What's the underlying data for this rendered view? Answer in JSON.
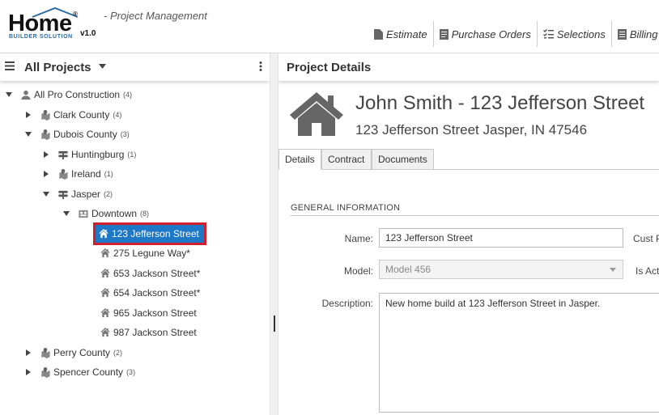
{
  "app": {
    "logo_text": "Home",
    "logo_reg": "®",
    "logo_sub": "BUILDER SOLUTION",
    "version": "v1.0",
    "subtitle": "- Project Management"
  },
  "toolbar": {
    "estimate": "Estimate",
    "purchase_orders": "Purchase Orders",
    "selections": "Selections",
    "billing": "Billing"
  },
  "left": {
    "title": "All Projects",
    "tree": [
      {
        "label": "All Pro Construction",
        "count": "(4)",
        "toggle": "open",
        "icon": "person"
      },
      {
        "label": "Clark County",
        "count": "(4)",
        "toggle": "closed",
        "icon": "county"
      },
      {
        "label": "Dubois County",
        "count": "(3)",
        "toggle": "open",
        "icon": "county"
      },
      {
        "label": "Huntingburg",
        "count": "(1)",
        "toggle": "closed",
        "icon": "city"
      },
      {
        "label": "Ireland",
        "count": "(1)",
        "toggle": "closed",
        "icon": "county"
      },
      {
        "label": "Jasper",
        "count": "(2)",
        "toggle": "open",
        "icon": "city"
      },
      {
        "label": "Downtown",
        "count": "(8)",
        "toggle": "open",
        "icon": "subdivision"
      },
      {
        "label": "123 Jefferson Street",
        "count": "",
        "toggle": "none",
        "icon": "house",
        "selected": true
      },
      {
        "label": "275 Legune Way*",
        "count": "",
        "toggle": "none",
        "icon": "house"
      },
      {
        "label": "653 Jackson Street*",
        "count": "",
        "toggle": "none",
        "icon": "house"
      },
      {
        "label": "654 Jackson Street*",
        "count": "",
        "toggle": "none",
        "icon": "house"
      },
      {
        "label": "965 Jackson Street",
        "count": "",
        "toggle": "none",
        "icon": "house"
      },
      {
        "label": "987 Jackson Street",
        "count": "",
        "toggle": "none",
        "icon": "house"
      },
      {
        "label": "Perry County",
        "count": "(2)",
        "toggle": "closed",
        "icon": "county"
      },
      {
        "label": "Spencer County",
        "count": "(3)",
        "toggle": "closed",
        "icon": "county"
      }
    ]
  },
  "right": {
    "title": "Project Details",
    "project_title": "John Smith - 123 Jefferson Street",
    "project_address": "123 Jefferson Street Jasper, IN 47546",
    "tabs": [
      "Details",
      "Contract",
      "Documents"
    ],
    "section": "GENERAL INFORMATION",
    "name_label": "Name:",
    "name_value": "123 Jefferson Street",
    "cust_label": "Cust P",
    "model_label": "Model:",
    "model_value": "Model 456",
    "active_label": "Is Act",
    "description_label": "Description:",
    "description_value": "New home build at 123 Jefferson Street in Jasper."
  },
  "colors": {
    "selection": "#1e78c8",
    "highlight_border": "#d21f2a",
    "logo_blue": "#2d6aa3"
  }
}
